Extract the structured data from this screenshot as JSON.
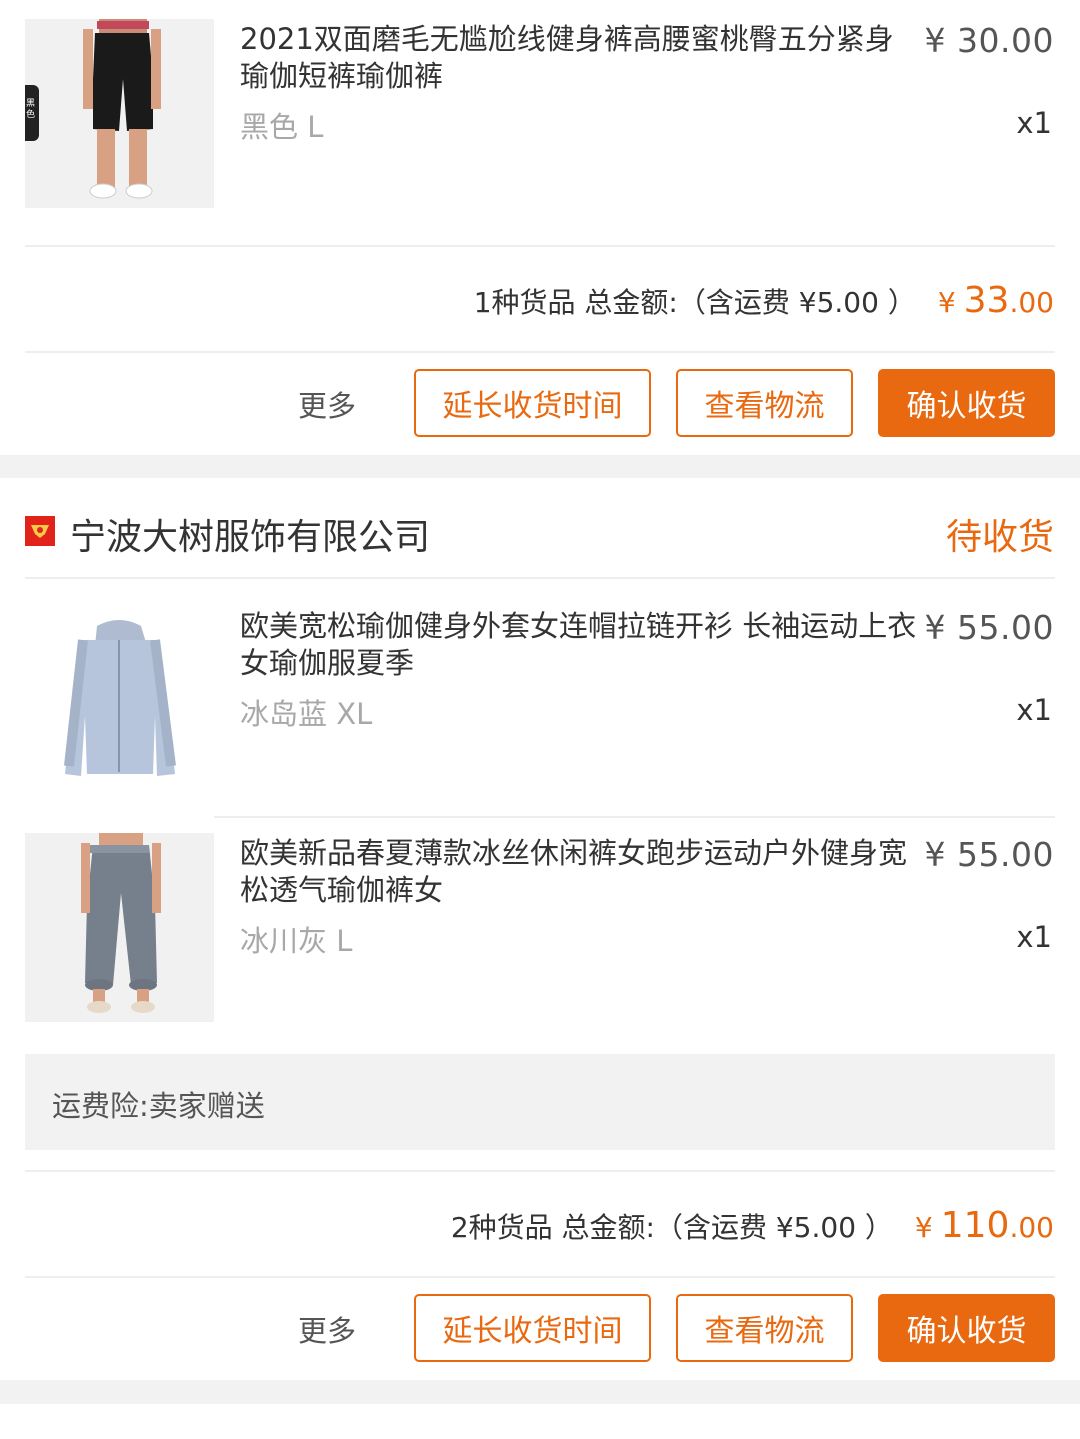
{
  "orders": [
    {
      "items": [
        {
          "title": "2021双面磨毛无尴尬线健身裤高腰蜜桃臀五分紧身瑜伽短裤瑜伽裤",
          "spec": "黑色 L",
          "price": "¥ 30.00",
          "qty": "x1",
          "thumb_badge": "黑色"
        }
      ],
      "summary": {
        "label": "1种货品 总金额:（含运费 ¥5.00 ）",
        "yen": "¥",
        "amount_int": "33",
        "amount_dec": ".00"
      },
      "actions": {
        "more": "更多",
        "extend": "延长收货时间",
        "logistics": "查看物流",
        "confirm": "确认收货"
      }
    },
    {
      "shop_name": "宁波大树服饰有限公司",
      "status": "待收货",
      "items": [
        {
          "title": "欧美宽松瑜伽健身外套女连帽拉链开衫 长袖运动上衣女瑜伽服夏季",
          "spec": "冰岛蓝 XL",
          "price": "¥ 55.00",
          "qty": "x1"
        },
        {
          "title": "欧美新品春夏薄款冰丝休闲裤女跑步运动户外健身宽松透气瑜伽裤女",
          "spec": "冰川灰 L",
          "price": "¥ 55.00",
          "qty": "x1"
        }
      ],
      "insurance": "运费险:卖家赠送",
      "summary": {
        "label": "2种货品 总金额:（含运费 ¥5.00 ）",
        "yen": "¥",
        "amount_int": "110",
        "amount_dec": ".00"
      },
      "actions": {
        "more": "更多",
        "extend": "延长收货时间",
        "logistics": "查看物流",
        "confirm": "确认收货"
      }
    }
  ],
  "colors": {
    "accent": "#e8690f",
    "shop_icon": "#e2231a",
    "page_bg": "#f2f2f2"
  }
}
